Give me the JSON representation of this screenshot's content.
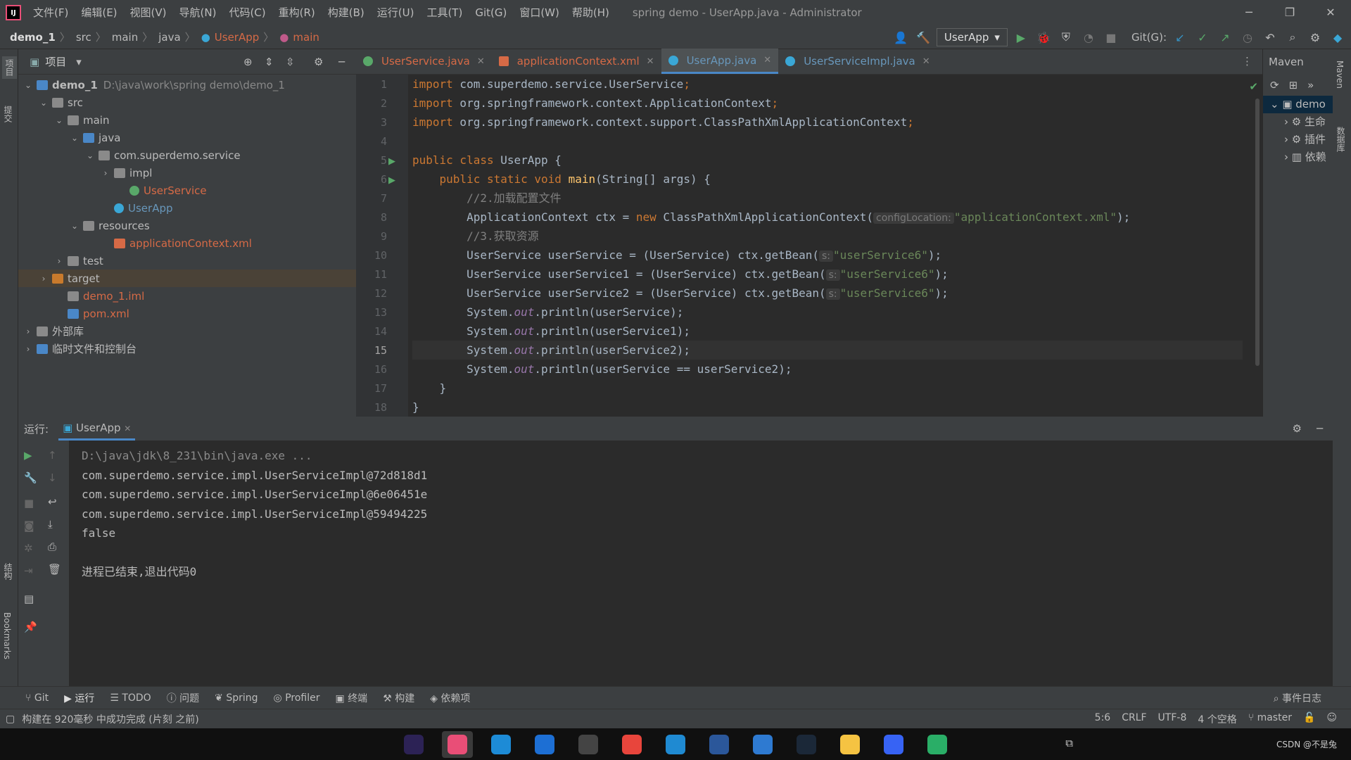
{
  "window": {
    "title": "spring demo - UserApp.java - Administrator",
    "menu": [
      "文件(F)",
      "编辑(E)",
      "视图(V)",
      "导航(N)",
      "代码(C)",
      "重构(R)",
      "构建(B)",
      "运行(U)",
      "工具(T)",
      "Git(G)",
      "窗口(W)",
      "帮助(H)"
    ]
  },
  "breadcrumb": [
    "demo_1",
    "src",
    "main",
    "java",
    "UserApp",
    "main"
  ],
  "toolbar": {
    "run_config": "UserApp",
    "git_label": "Git(G):"
  },
  "project_panel": {
    "title": "项目",
    "tree": [
      {
        "label": "demo_1",
        "path": "D:\\java\\work\\spring demo\\demo_1",
        "indent": 0,
        "arrow": "down",
        "icon": "module",
        "color": "#bbbbbb",
        "bold": true
      },
      {
        "label": "src",
        "indent": 1,
        "arrow": "down",
        "icon": "folder",
        "color": "#bbbbbb"
      },
      {
        "label": "main",
        "indent": 2,
        "arrow": "down",
        "icon": "folder",
        "color": "#bbbbbb"
      },
      {
        "label": "java",
        "indent": 3,
        "arrow": "down",
        "icon": "folder-blue",
        "color": "#bbbbbb"
      },
      {
        "label": "com.superdemo.service",
        "indent": 4,
        "arrow": "down",
        "icon": "package",
        "color": "#bbbbbb"
      },
      {
        "label": "impl",
        "indent": 5,
        "arrow": "right",
        "icon": "package",
        "color": "#bbbbbb"
      },
      {
        "label": "UserService",
        "indent": 6,
        "arrow": "",
        "icon": "interface",
        "color": "#d66a46"
      },
      {
        "label": "UserApp",
        "indent": 5,
        "arrow": "",
        "icon": "class",
        "color": "#6897bb"
      },
      {
        "label": "resources",
        "indent": 3,
        "arrow": "down",
        "icon": "folder-res",
        "color": "#bbbbbb"
      },
      {
        "label": "applicationContext.xml",
        "indent": 5,
        "arrow": "",
        "icon": "xml",
        "color": "#d66a46"
      },
      {
        "label": "test",
        "indent": 2,
        "arrow": "right",
        "icon": "folder",
        "color": "#bbbbbb"
      },
      {
        "label": "target",
        "indent": 1,
        "arrow": "right",
        "icon": "folder-orange",
        "color": "#bbbbbb",
        "selected": true
      },
      {
        "label": "demo_1.iml",
        "indent": 2,
        "arrow": "",
        "icon": "iml",
        "color": "#d66a46"
      },
      {
        "label": "pom.xml",
        "indent": 2,
        "arrow": "",
        "icon": "maven",
        "color": "#d66a46"
      },
      {
        "label": "外部库",
        "indent": 0,
        "arrow": "right",
        "icon": "lib",
        "color": "#bbbbbb"
      },
      {
        "label": "临时文件和控制台",
        "indent": 0,
        "arrow": "right",
        "icon": "scratch",
        "color": "#bbbbbb"
      }
    ]
  },
  "editor": {
    "tabs": [
      {
        "label": "UserService.java",
        "icon": "interface",
        "color": "#d66a46",
        "active": false
      },
      {
        "label": "applicationContext.xml",
        "icon": "xml",
        "color": "#d66a46",
        "active": false
      },
      {
        "label": "UserApp.java",
        "icon": "class",
        "color": "#6897bb",
        "active": true
      },
      {
        "label": "UserServiceImpl.java",
        "icon": "class",
        "color": "#6897bb",
        "active": false
      }
    ],
    "line_numbers": [
      "1",
      "2",
      "3",
      "4",
      "5",
      "6",
      "7",
      "8",
      "9",
      "10",
      "11",
      "12",
      "13",
      "14",
      "15",
      "16",
      "17",
      "18"
    ],
    "current_line": "15",
    "hint_config": "configLocation:",
    "hint_s": "s:",
    "code": {
      "l1a": "import",
      "l1b": " com.superdemo.service.UserService",
      "l2a": "import",
      "l2b": " org.springframework.context.ApplicationContext",
      "l3a": "import",
      "l3b": " org.springframework.context.support.ClassPathXmlApplicationContext",
      "l5a": "public class",
      "l5b": " UserApp {",
      "l6a": "    public static void ",
      "l6b": "main",
      "l6c": "(String[] args) {",
      "l7": "        //2.加载配置文件",
      "l8a": "        ApplicationContext ctx = ",
      "l8b": "new",
      " l8c": " ClassPathXmlApplicationContext(",
      "l8d": "\"applicationContext.xml\"",
      "l8e": ");",
      "l9": "        //3.获取资源",
      "l10a": "        UserService userService = (UserService) ctx.getBean(",
      "l10b": "\"userService6\"",
      "l10c": ");",
      "l11a": "        UserService userService1 = (UserService) ctx.getBean(",
      "l11b": "\"userService6\"",
      "l11c": ");",
      "l12a": "        UserService userService2 = (UserService) ctx.getBean(",
      "l12b": "\"userService6\"",
      "l12c": ");",
      "sys": "        System.",
      "out": "out",
      "p13": ".println(userService);",
      "p14": ".println(userService1);",
      "p15": ".println(userService2);",
      "p16": ".println(userService == userService2);",
      "l17": "    }",
      "l18": "}"
    }
  },
  "maven": {
    "title": "Maven",
    "items": [
      "demo",
      "生命",
      "插件",
      "依赖"
    ]
  },
  "run": {
    "label": "运行:",
    "tab": "UserApp",
    "output": [
      "D:\\java\\jdk\\8_231\\bin\\java.exe ...",
      "com.superdemo.service.impl.UserServiceImpl@72d818d1",
      "com.superdemo.service.impl.UserServiceImpl@6e06451e",
      "com.superdemo.service.impl.UserServiceImpl@59494225",
      "false",
      "",
      "进程已结束,退出代码0"
    ]
  },
  "left_strip": {
    "project": "项目",
    "commit": "提交",
    "structure": "结构",
    "bookmarks": "Bookmarks"
  },
  "right_strip": {
    "maven": "Maven",
    "database": "数据库"
  },
  "bottom_tabs": [
    "Git",
    "运行",
    "TODO",
    "问题",
    "Spring",
    "Profiler",
    "终端",
    "构建",
    "依赖项"
  ],
  "status": {
    "message": "构建在 920毫秒 中成功完成 (片刻 之前)",
    "event_log": "事件日志",
    "position": "5:6",
    "line_sep": "CRLF",
    "encoding": "UTF-8",
    "indent": "4 个空格",
    "branch": "master"
  },
  "taskbar": {
    "apps": [
      {
        "name": "eclipse-icon",
        "color": "#2c2255"
      },
      {
        "name": "intellij-icon",
        "color": "#e94e77",
        "active": true
      },
      {
        "name": "edge-dev-icon",
        "color": "#1d8bd6"
      },
      {
        "name": "vmware-icon",
        "color": "#1d6fd4"
      },
      {
        "name": "terminal-icon",
        "color": "#444444"
      },
      {
        "name": "chrome-icon",
        "color": "#e8453c"
      },
      {
        "name": "vscode-icon",
        "color": "#1f8ad2"
      },
      {
        "name": "word-icon",
        "color": "#2b579a"
      },
      {
        "name": "todo-icon",
        "color": "#2e7ad1"
      },
      {
        "name": "steam-icon",
        "color": "#1b2838"
      },
      {
        "name": "file-explorer-icon",
        "color": "#f5c342"
      },
      {
        "name": "video-app-icon",
        "color": "#3763f4"
      },
      {
        "name": "wechat-icon",
        "color": "#2aae67"
      }
    ],
    "watermark": "CSDN @不是兔"
  }
}
